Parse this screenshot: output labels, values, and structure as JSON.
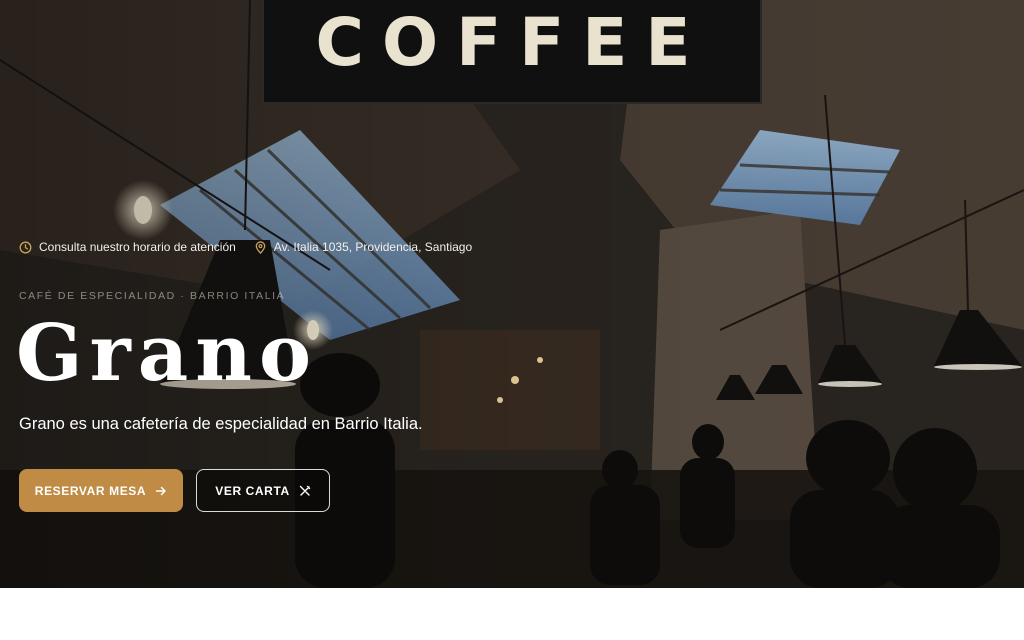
{
  "hero": {
    "sign_text": "COFFEE",
    "info": {
      "hours": "Consulta nuestro horario de atención",
      "hours_icon": "clock-icon",
      "address": "Av. Italia 1035, Providencia, Santiago",
      "address_icon": "map-pin-icon"
    },
    "eyebrow": "CAFÉ DE ESPECIALIDAD · BARRIO ITALIA",
    "title": "Grano",
    "subtitle": "Grano es una cafetería de especialidad en Barrio Italia.",
    "buttons": {
      "reserve_label": "RESERVAR MESA",
      "reserve_icon": "arrow-right-icon",
      "menu_label": "VER CARTA",
      "menu_icon": "utensils-icon"
    }
  },
  "colors": {
    "accent": "#bf8b45",
    "text": "#ffffff",
    "icon_accent": "#c9a45a"
  }
}
